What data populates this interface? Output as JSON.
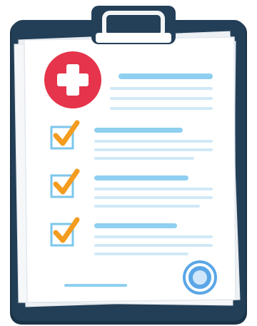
{
  "illustration": {
    "subject": "medical-checklist-clipboard",
    "colors": {
      "board": "#233f57",
      "board_shadow": "#1b3347",
      "clip": "#243f58",
      "clip_ring": "#f2f4f6",
      "paper": "#ffffff",
      "paper_back": "#eef1f4",
      "paper_edge": "#dfe4ea",
      "medical_badge": "#e5344b",
      "medical_cross": "#ffffff",
      "line_strong": "#8fcff0",
      "line_soft": "#cfe9f7",
      "checkbox_border": "#7cc6ec",
      "checkmark": "#f39c1f",
      "stamp": "#5aa6e6",
      "stamp_light": "#cfe6fb"
    },
    "icons": [
      "medical-cross-icon",
      "checkbox-checked-icon",
      "stamp-seal-icon",
      "clipboard-clip-icon"
    ],
    "checklist": [
      {
        "checked": true
      },
      {
        "checked": true
      },
      {
        "checked": true
      }
    ]
  }
}
